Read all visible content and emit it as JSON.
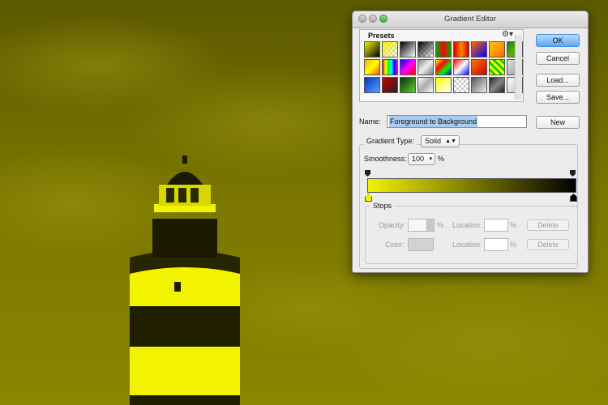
{
  "window": {
    "title": "Gradient Editor"
  },
  "presets": {
    "label": "Presets",
    "menu_icon": "gear-icon"
  },
  "buttons": {
    "ok": "OK",
    "cancel": "Cancel",
    "load": "Load...",
    "save": "Save...",
    "new": "New"
  },
  "name_row": {
    "label": "Name:",
    "value": "Foreground to Background"
  },
  "gradient_type": {
    "label": "Gradient Type:",
    "value": "Solid"
  },
  "smoothness": {
    "label": "Smoothness:",
    "value": "100",
    "unit": "%"
  },
  "gradient": {
    "start_color": "#f2f200",
    "end_color": "#000000"
  },
  "stops": {
    "label": "Stops",
    "opacity_label": "Opacity:",
    "opacity_unit": "%",
    "location_label": "Location:",
    "location_unit": "%",
    "color_label": "Color:",
    "delete_label": "Delete"
  },
  "colors": {
    "accent": "#5ba6f3",
    "background_tint": "#8a8600",
    "highlight": "#f3f300"
  }
}
